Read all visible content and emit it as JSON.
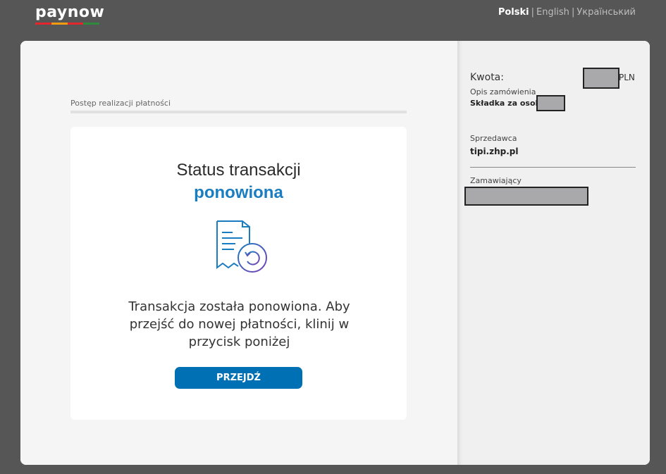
{
  "header": {
    "logo_text": "paynow",
    "logo_colors": [
      "#e3262e",
      "#f39c12",
      "#e3262e",
      "#2e8b3e",
      "#2e8b3e"
    ],
    "languages": [
      {
        "label": "Polski",
        "active": true
      },
      {
        "label": "English",
        "active": false
      },
      {
        "label": "Український",
        "active": false
      }
    ],
    "separator": "|"
  },
  "progress": {
    "label": "Postęp realizacji płatności"
  },
  "status": {
    "title": "Status transakcji",
    "value": "ponowiona",
    "icon": "receipt-refresh-icon",
    "message": "Transakcja została ponowiona. Aby przejść do nowej płatności, klinij w przycisk poniżej",
    "button_label": "PRZEJDŹ"
  },
  "summary": {
    "amount_label": "Kwota:",
    "currency": "PLN",
    "description_label": "Opis zamówienia",
    "description_value": "Składka za osoby:",
    "seller_label": "Sprzedawca",
    "seller_value": "tipi.zhp.pl",
    "buyer_label": "Zamawiający"
  },
  "colors": {
    "accent": "#1a7dc1",
    "button": "#0070b5",
    "background": "#575656"
  }
}
